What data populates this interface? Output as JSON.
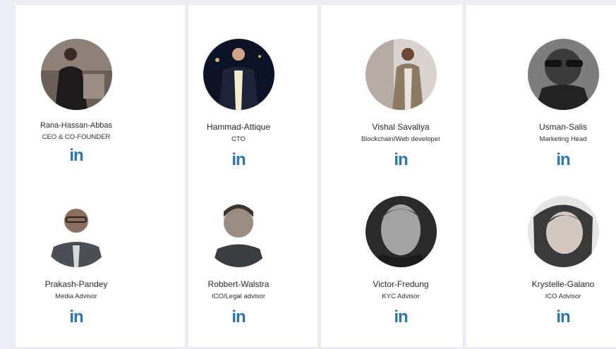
{
  "members": [
    {
      "name": "Rana-Hassan-Abbas",
      "role": "CEO & CO-FOUNDER",
      "icon": "linkedin-icon",
      "link_glyph": "in"
    },
    {
      "name": "Hammad-Attique",
      "role": "CTO",
      "icon": "linkedin-icon",
      "link_glyph": "in"
    },
    {
      "name": "Vishal Savaliya",
      "role": "Blockchain/Web developer",
      "icon": "linkedin-icon",
      "link_glyph": "in"
    },
    {
      "name": "Usman-Salis",
      "role": "Marketing Head",
      "icon": "linkedin-icon",
      "link_glyph": "in"
    },
    {
      "name": "Prakash-Pandey",
      "role": "Media Advisor",
      "icon": "linkedin-icon",
      "link_glyph": "in"
    },
    {
      "name": "Robbert-Walstra",
      "role": "ICO/Legal advisor",
      "icon": "linkedin-icon",
      "link_glyph": "in"
    },
    {
      "name": "Victor-Fredung",
      "role": "KYC Advisor",
      "icon": "linkedin-icon",
      "link_glyph": "in"
    },
    {
      "name": "Krystelle-Galano",
      "role": "ICO Advisor",
      "icon": "linkedin-icon",
      "link_glyph": "in"
    }
  ],
  "colors": {
    "linkedin": "#2c75b5",
    "card": "#ffffff",
    "page_bg": "#eceef3"
  }
}
